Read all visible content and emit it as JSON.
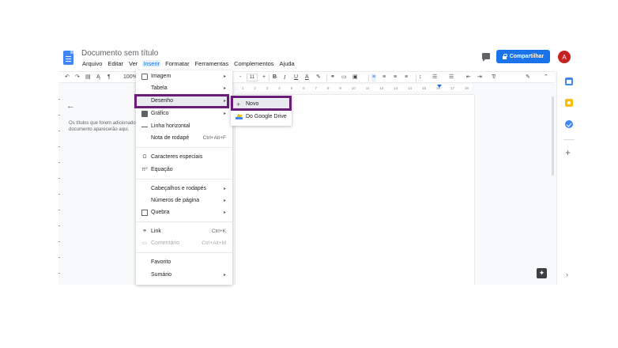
{
  "header": {
    "doc_title": "Documento sem título",
    "menus": [
      "Arquivo",
      "Editar",
      "Ver",
      "Inserir",
      "Formatar",
      "Ferramentas",
      "Complementos",
      "Ajuda"
    ],
    "active_menu": "Inserir",
    "share_label": "Compartilhar",
    "avatar_letter": "A"
  },
  "toolbar": {
    "zoom": "100%",
    "font_size": "11",
    "bold": "B",
    "italic": "I",
    "underline": "U",
    "text_color": "A",
    "minus": "-",
    "plus": "+"
  },
  "ruler": {
    "labels": [
      "1",
      "2",
      "3",
      "4",
      "5",
      "6",
      "7",
      "8",
      "9",
      "10",
      "11",
      "12",
      "13",
      "14",
      "15",
      "16",
      "17",
      "18"
    ]
  },
  "outline": {
    "text_line1": "Os títulos que forem adicionados ao",
    "text_line2": "documento aparecerão aqui."
  },
  "insert_menu": {
    "items": [
      {
        "label": "Imagem",
        "icon": "image-icon",
        "submenu": true
      },
      {
        "label": "Tabela",
        "icon": "",
        "submenu": true
      },
      {
        "label": "Desenho",
        "icon": "",
        "submenu": true
      },
      {
        "label": "Gráfico",
        "icon": "chart-icon",
        "submenu": true
      },
      {
        "label": "Linha horizontal",
        "icon": "horizontal-line-icon"
      },
      {
        "label": "Nota de rodapé",
        "shortcut": "Ctrl+Alt+F"
      },
      {
        "label": "Caracteres especiais",
        "icon": "omega-icon"
      },
      {
        "label": "Equação",
        "icon": "pi-icon"
      },
      {
        "label": "Cabeçalhos e rodapés",
        "submenu": true
      },
      {
        "label": "Números de página",
        "submenu": true
      },
      {
        "label": "Quebra",
        "icon": "page-break-icon",
        "submenu": true
      },
      {
        "label": "Link",
        "icon": "link-icon",
        "shortcut": "Ctrl+K"
      },
      {
        "label": "Comentário",
        "icon": "comment-icon",
        "shortcut": "Ctrl+Alt+M",
        "disabled": true
      },
      {
        "label": "Favorito"
      },
      {
        "label": "Sumário",
        "submenu": true
      }
    ],
    "submenu_arrow": "▸",
    "highlighted": "Desenho"
  },
  "drawing_submenu": {
    "items": [
      {
        "label": "Novo",
        "icon": "plus-icon"
      },
      {
        "label": "Do Google Drive",
        "icon": "google-drive-icon"
      }
    ],
    "highlighted": "Novo"
  },
  "side_panel": {
    "plus": "+",
    "chevron": "›"
  },
  "colors": {
    "accent": "#1a73e8",
    "highlight_border": "#6a1b79",
    "avatar_bg": "#c5221f"
  }
}
